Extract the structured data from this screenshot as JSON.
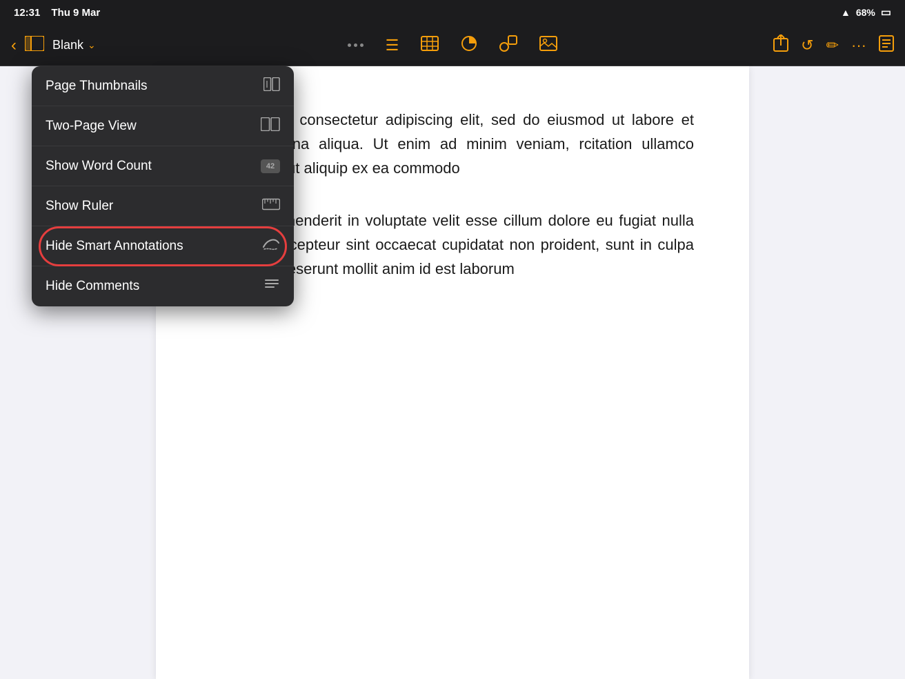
{
  "statusBar": {
    "time": "12:31",
    "date": "Thu 9 Mar",
    "wifi": "WiFi",
    "battery": "68%"
  },
  "toolbar": {
    "docTitle": "Blank",
    "dots": "•••"
  },
  "menu": {
    "items": [
      {
        "id": "page-thumbnails",
        "label": "Page Thumbnails",
        "icon": "thumbnails"
      },
      {
        "id": "two-page-view",
        "label": "Two-Page View",
        "icon": "two-page"
      },
      {
        "id": "show-word-count",
        "label": "Show Word Count",
        "icon": "word-count"
      },
      {
        "id": "show-ruler",
        "label": "Show Ruler",
        "icon": "ruler"
      },
      {
        "id": "hide-smart-annotations",
        "label": "Hide Smart Annotations",
        "icon": "annotations",
        "highlighted": true
      },
      {
        "id": "hide-comments",
        "label": "Hide Comments",
        "icon": "comments"
      }
    ]
  },
  "document": {
    "text1": "or sit amet, consectetur adipiscing elit, sed do eiusmod ut labore et dolore magna aliqua. Ut enim ad minim veniam, rcitation ullamco laboris nisi ut aliquip ex ea commodo",
    "text2": "lor in reprehenderit in voluptate velit esse cillum dolore eu fugiat nulla pariatur. Excepteur sint occaecat cupidatat non proident, sunt in culpa qui officia deserunt mollit anim id est laborum"
  }
}
